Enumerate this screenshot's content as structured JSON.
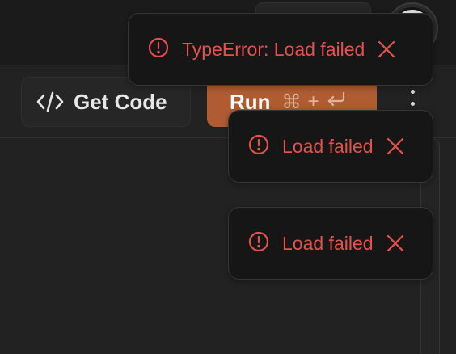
{
  "toolbar": {
    "get_code_label": "Get Code",
    "get_code_icon": "code-brackets-icon",
    "run_label": "Run",
    "run_shortcut": {
      "cmd_symbol": "⌘",
      "plus": "+",
      "enter_icon": "enter-key-icon"
    },
    "more_icon": "kebab-menu-icon"
  },
  "toasts": [
    {
      "message": "TypeError: Load failed",
      "icon": "alert-circle-icon",
      "close_icon": "close-icon"
    },
    {
      "message": "Load failed",
      "icon": "alert-circle-icon",
      "close_icon": "close-icon"
    },
    {
      "message": "Load failed",
      "icon": "alert-circle-icon",
      "close_icon": "close-icon"
    }
  ],
  "colors": {
    "background": "#1a1a1a",
    "panel": "#222222",
    "run_accent": "#b05c33",
    "error": "#e5524e",
    "toast_background": "#161616"
  }
}
